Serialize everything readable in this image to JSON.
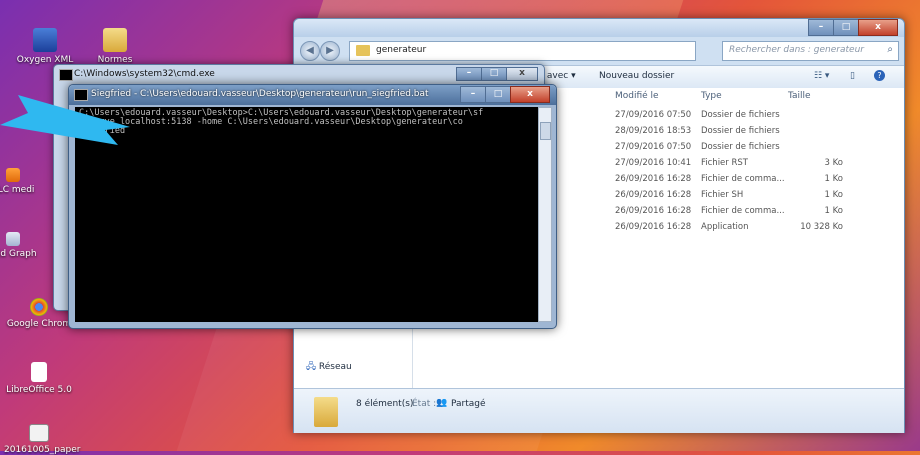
{
  "desktop": {
    "icons": [
      {
        "label": "Oxygen XML"
      },
      {
        "label": "Normes"
      },
      {
        "label": "VLC medi"
      },
      {
        "label": "yEd Graph"
      },
      {
        "label": "Google Chrom"
      },
      {
        "label": "LibreOffice 5.0"
      },
      {
        "label": "20161005_paper"
      }
    ]
  },
  "explorer": {
    "address": "generateur",
    "search_placeholder": "Rechercher dans : generateur",
    "toolbar": {
      "open_with": "Ouvrir avec ▾",
      "new_folder": "Nouveau dossier"
    },
    "columns": {
      "modified": "Modifié le",
      "type": "Type",
      "size": "Taille"
    },
    "files": [
      {
        "modified": "27/09/2016 07:50",
        "type": "Dossier de fichiers",
        "size": ""
      },
      {
        "modified": "28/09/2016 18:53",
        "type": "Dossier de fichiers",
        "size": ""
      },
      {
        "modified": "27/09/2016 07:50",
        "type": "Dossier de fichiers",
        "size": ""
      },
      {
        "modified": "27/09/2016 10:41",
        "type": "Fichier RST",
        "size": "3 Ko"
      },
      {
        "modified": "26/09/2016 16:28",
        "type": "Fichier de comma...",
        "size": "1 Ko"
      },
      {
        "modified": "26/09/2016 16:28",
        "type": "Fichier SH",
        "size": "1 Ko"
      },
      {
        "modified": "26/09/2016 16:28",
        "type": "Fichier de comma...",
        "size": "1 Ko"
      },
      {
        "modified": "26/09/2016 16:28",
        "type": "Application",
        "size": "10 328 Ko"
      }
    ],
    "nav_network": "Réseau",
    "status_count": "8 élément(s)",
    "status_state_label": "État :",
    "status_state_value": "Partagé"
  },
  "cmd_back": {
    "title": "C:\\Windows\\system32\\cmd.exe"
  },
  "cmd_front": {
    "title": "Siegfried - C:\\Users\\edouard.vasseur\\Desktop\\generateur\\run_siegfried.bat",
    "console": "C:\\Users\\edouard.vasseur\\Desktop>C:\\Users\\edouard.vasseur\\Desktop\\generateur\\sf\n -serve localhost:5138 -home C:\\Users\\edouard.vasseur\\Desktop\\generateur\\co\nsiegfried"
  },
  "colors": {
    "accent": "#2fb8f0"
  }
}
